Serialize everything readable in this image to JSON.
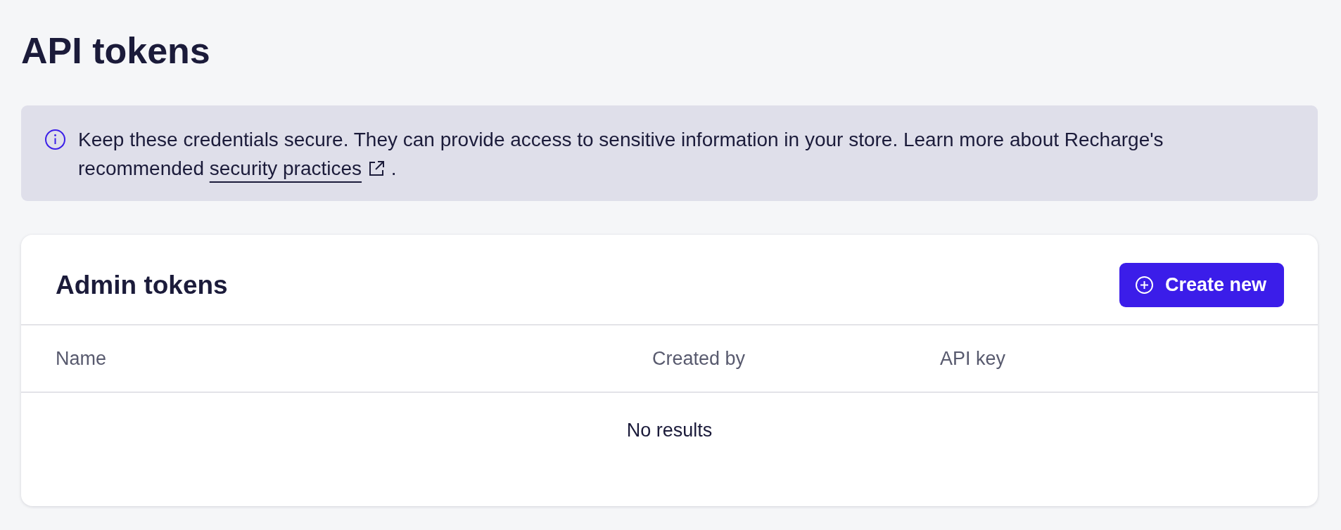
{
  "title": "API tokens",
  "banner": {
    "text": "Keep these credentials secure. They can provide access to sensitive information in your store. Learn more about Recharge's recommended",
    "link": "security practices",
    "end": "."
  },
  "card": {
    "title": "Admin tokens",
    "button": "Create new",
    "table": {
      "columns": [
        "Name",
        "Created by",
        "API key"
      ],
      "empty_message": "No results"
    }
  }
}
